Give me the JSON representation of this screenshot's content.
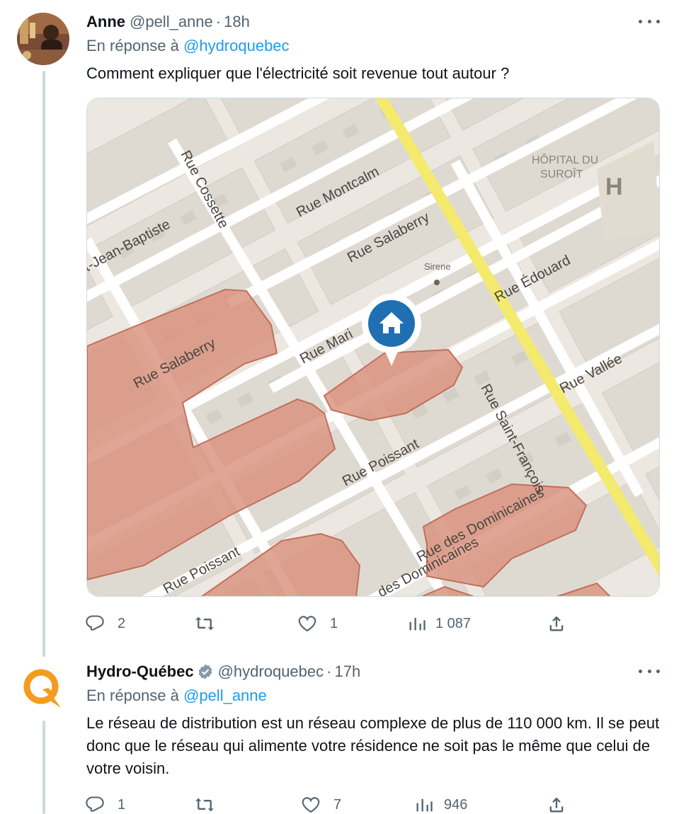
{
  "tweets": [
    {
      "author_name": "Anne",
      "handle": "@pell_anne",
      "separator": "·",
      "time": "18h",
      "reply_prefix": "En réponse à",
      "reply_to": "@hydroquebec",
      "text": "Comment expliquer que l'électricité soit revenue tout autour ?",
      "map_labels": {
        "montcalm": "Rue Montcalm",
        "cossette": "Rue Cossette",
        "jean_baptiste": "t-Jean-Baptiste",
        "salaberry_top": "Rue Salaberry",
        "sirene": "Sirene",
        "hopital_1": "HÔPITAL DU",
        "hopital_2": "SUROÎT",
        "hospital_h": "H",
        "edouard": "Rue Édouard",
        "marie": "Rue Mari",
        "vallee": "Rue Vallée",
        "salaberry_left": "Rue Salaberry",
        "poissant_mid": "Rue Poissant",
        "saint_francois": "Rue Saint-François",
        "dominicaines": "Rue des Dominicaines",
        "poissant_bottom": "Rue Poissant",
        "des_dominicaines": "des Dominicaines"
      },
      "stats": {
        "replies": "2",
        "retweets": "",
        "likes": "1",
        "views": "1 087"
      }
    },
    {
      "author_name": "Hydro-Québec",
      "handle": "@hydroquebec",
      "separator": "·",
      "time": "17h",
      "reply_prefix": "En réponse à",
      "reply_to": "@pell_anne",
      "text": "Le réseau de distribution est un réseau complexe de plus de 110 000 km. Il se peut donc que le réseau qui alimente votre résidence ne soit pas le même que celui de votre voisin.",
      "stats": {
        "replies": "1",
        "retweets": "",
        "likes": "7",
        "views": "946"
      }
    }
  ],
  "colors": {
    "link": "#1d9bf0",
    "secondary_text": "#536471",
    "verified_gold": "#829aab",
    "hydro_orange": "#f39c1f",
    "outage_fill": "#d98f7a",
    "highway": "#f3ea6e",
    "marker": "#1f6fb2"
  },
  "icons": [
    "reply-icon",
    "retweet-icon",
    "like-icon",
    "views-icon",
    "share-icon",
    "more-icon",
    "verified-icon",
    "home-icon"
  ]
}
